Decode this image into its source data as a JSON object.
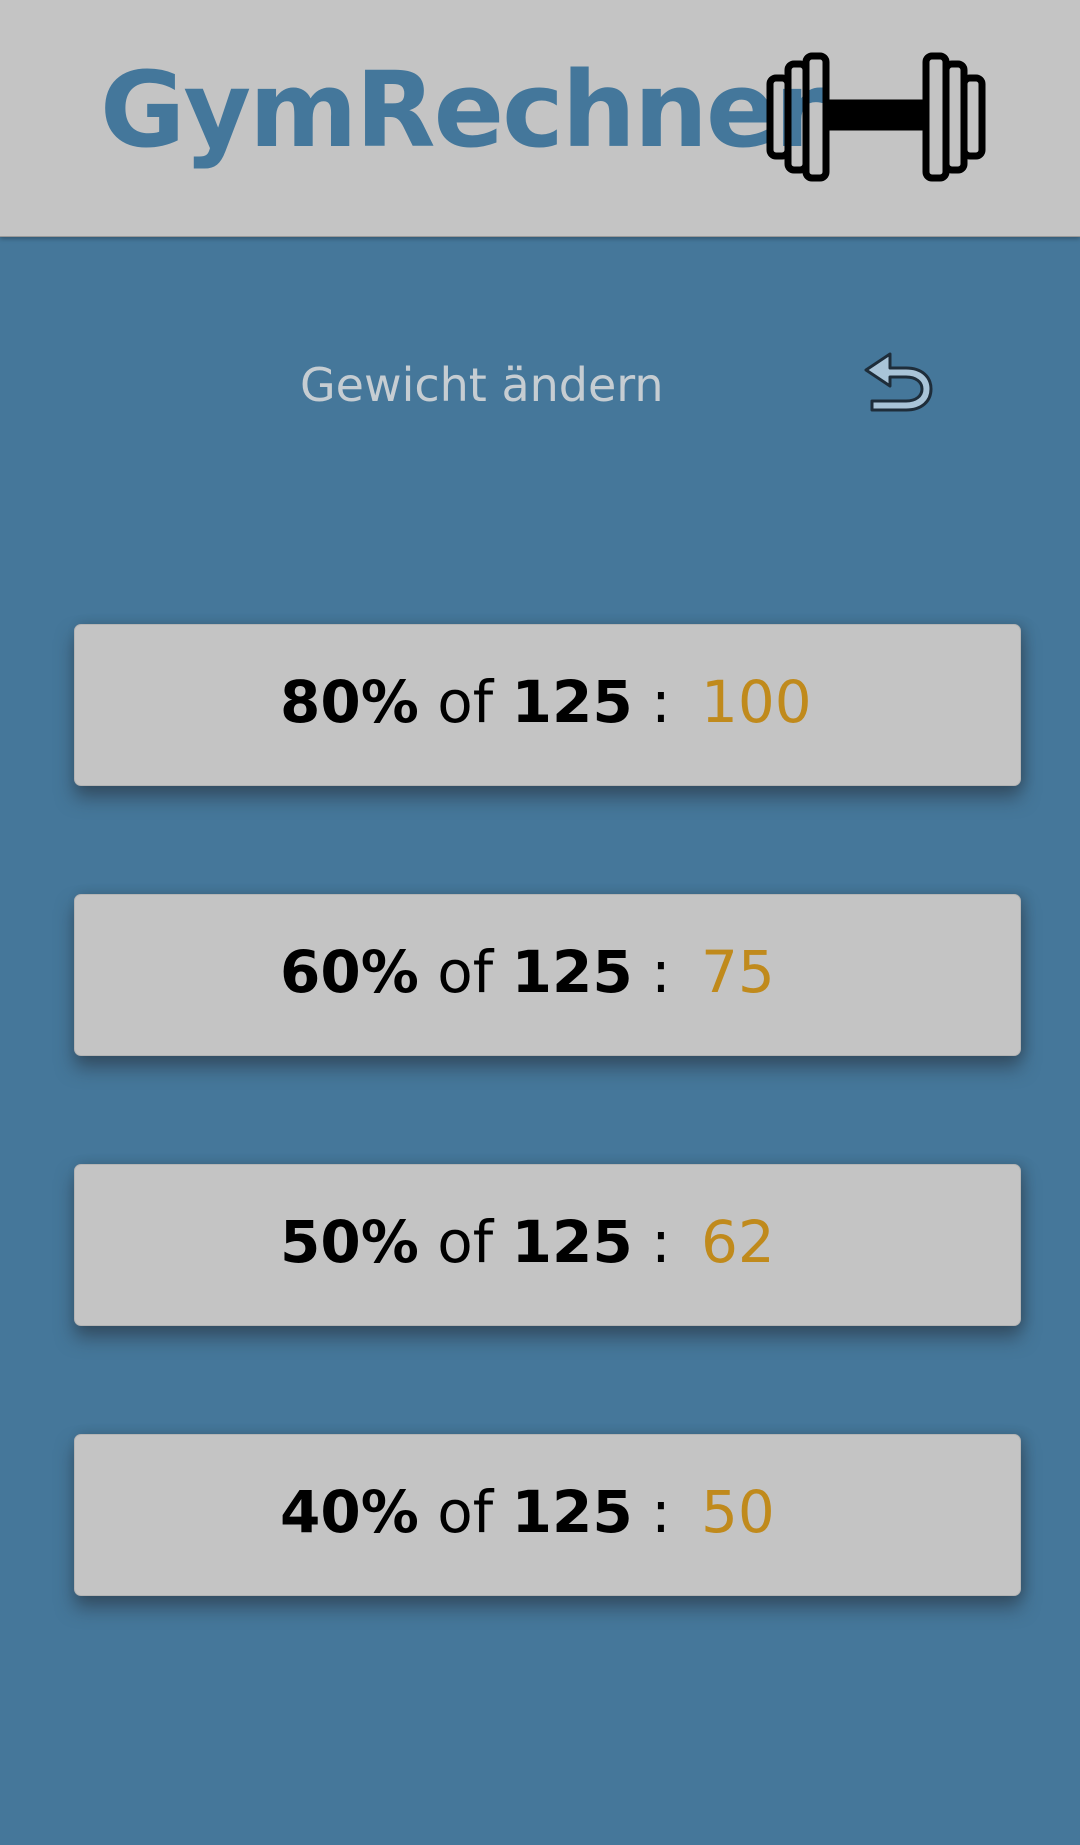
{
  "header": {
    "title": "GymRechner",
    "logo_icon": "dumbbell-icon"
  },
  "controls": {
    "change_weight_label": "Gewicht ändern",
    "back_icon": "undo-arrow-icon"
  },
  "colors": {
    "background": "#45779a",
    "header_background": "#c4c4c4",
    "title": "#44779b",
    "result": "#c08a1c",
    "card": "#c4c4c4"
  },
  "results": [
    {
      "percent": "80%",
      "of": "of",
      "base": "125",
      "colon": ":",
      "value": "100"
    },
    {
      "percent": "60%",
      "of": "of",
      "base": "125",
      "colon": ":",
      "value": "75"
    },
    {
      "percent": "50%",
      "of": "of",
      "base": "125",
      "colon": ":",
      "value": "62"
    },
    {
      "percent": "40%",
      "of": "of",
      "base": "125",
      "colon": ":",
      "value": "50"
    }
  ]
}
